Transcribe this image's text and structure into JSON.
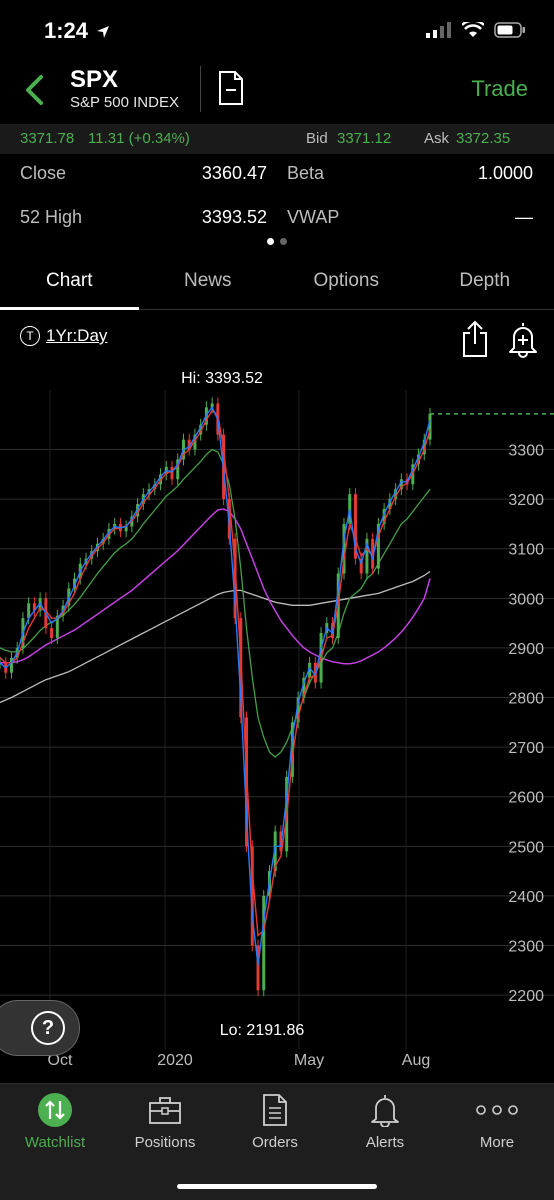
{
  "status_bar": {
    "time": "1:24"
  },
  "header": {
    "symbol": "SPX",
    "name": "S&P 500 INDEX",
    "trade_label": "Trade"
  },
  "quote": {
    "last": "3371.78",
    "change": "11.31 (+0.34%)",
    "bid_label": "Bid",
    "bid": "3371.12",
    "ask_label": "Ask",
    "ask": "3372.35"
  },
  "stats": {
    "close_label": "Close",
    "close": "3360.47",
    "beta_label": "Beta",
    "beta": "1.0000",
    "high52_label": "52 High",
    "high52": "3393.52",
    "vwap_label": "VWAP",
    "vwap": "—"
  },
  "tabs": [
    {
      "label": "Chart",
      "active": true
    },
    {
      "label": "News"
    },
    {
      "label": "Options"
    },
    {
      "label": "Depth"
    }
  ],
  "chart_toolbar": {
    "timeframe_badge": "T",
    "timeframe": "1Yr:Day"
  },
  "chart_data": {
    "type": "line",
    "hi_label": "Hi: 3393.52",
    "lo_label": "Lo: 2191.86",
    "y_ticks": [
      3300,
      3200,
      3100,
      3000,
      2900,
      2800,
      2700,
      2600,
      2500,
      2400,
      2300,
      2200
    ],
    "ylim": [
      2170,
      3420
    ],
    "x_tick_labels": [
      "Oct",
      "2020",
      "May",
      "Aug"
    ],
    "last_price_line": 3371.78,
    "colors": {
      "price_up": "#4caf50",
      "price_down": "#e53935",
      "ma_fast": "#2979ff",
      "ma_short": "#e53935",
      "ma_mid": "#43a047",
      "ma_long": "#c040e0",
      "ma_longest": "#bdbdbd"
    },
    "price_series": [
      2870,
      2850,
      2880,
      2900,
      2960,
      2990,
      2975,
      3000,
      2940,
      2920,
      2965,
      2985,
      3020,
      3040,
      3070,
      3080,
      3095,
      3110,
      3120,
      3140,
      3150,
      3135,
      3145,
      3165,
      3190,
      3210,
      3220,
      3230,
      3250,
      3265,
      3240,
      3280,
      3320,
      3300,
      3330,
      3350,
      3385,
      3393,
      3330,
      3200,
      3120,
      2960,
      2760,
      2500,
      2300,
      2210,
      2400,
      2450,
      2530,
      2490,
      2640,
      2750,
      2800,
      2840,
      2870,
      2830,
      2930,
      2950,
      2920,
      3050,
      3150,
      3210,
      3080,
      3050,
      3120,
      3060,
      3150,
      3180,
      3200,
      3220,
      3240,
      3230,
      3270,
      3290,
      3320,
      3372
    ],
    "ma_fast": [
      2870,
      2860,
      2870,
      2890,
      2930,
      2960,
      2975,
      2990,
      2970,
      2950,
      2960,
      2975,
      3000,
      3025,
      3055,
      3075,
      3090,
      3105,
      3118,
      3133,
      3145,
      3142,
      3145,
      3160,
      3180,
      3200,
      3215,
      3228,
      3245,
      3258,
      3255,
      3270,
      3300,
      3305,
      3325,
      3345,
      3370,
      3385,
      3360,
      3260,
      3150,
      2990,
      2800,
      2560,
      2360,
      2260,
      2350,
      2430,
      2500,
      2500,
      2600,
      2720,
      2790,
      2830,
      2860,
      2845,
      2900,
      2940,
      2930,
      3020,
      3120,
      3180,
      3100,
      3070,
      3110,
      3080,
      3140,
      3170,
      3195,
      3215,
      3235,
      3235,
      3260,
      3285,
      3315,
      3360
    ],
    "ma_short": [
      2880,
      2870,
      2870,
      2880,
      2910,
      2940,
      2960,
      2980,
      2975,
      2960,
      2960,
      2970,
      2990,
      3010,
      3040,
      3065,
      3085,
      3100,
      3112,
      3128,
      3140,
      3142,
      3146,
      3156,
      3172,
      3192,
      3208,
      3222,
      3238,
      3252,
      3256,
      3266,
      3290,
      3300,
      3318,
      3336,
      3360,
      3378,
      3370,
      3300,
      3200,
      3060,
      2880,
      2650,
      2450,
      2320,
      2330,
      2390,
      2460,
      2480,
      2560,
      2680,
      2760,
      2805,
      2840,
      2845,
      2880,
      2920,
      2925,
      2990,
      3080,
      3150,
      3120,
      3085,
      3100,
      3085,
      3125,
      3155,
      3180,
      3205,
      3225,
      3232,
      3252,
      3275,
      3300,
      3340
    ],
    "ma_mid": [
      2900,
      2895,
      2892,
      2892,
      2898,
      2910,
      2922,
      2935,
      2945,
      2952,
      2958,
      2966,
      2976,
      2988,
      3002,
      3018,
      3034,
      3050,
      3064,
      3078,
      3092,
      3102,
      3110,
      3120,
      3134,
      3150,
      3164,
      3178,
      3192,
      3206,
      3216,
      3226,
      3240,
      3252,
      3264,
      3276,
      3290,
      3300,
      3295,
      3270,
      3230,
      3160,
      3060,
      2940,
      2840,
      2760,
      2720,
      2690,
      2680,
      2690,
      2710,
      2740,
      2770,
      2800,
      2830,
      2850,
      2870,
      2890,
      2900,
      2930,
      2970,
      3000,
      3010,
      3020,
      3040,
      3050,
      3070,
      3090,
      3110,
      3130,
      3150,
      3160,
      3175,
      3190,
      3205,
      3220
    ],
    "ma_long": [
      2870,
      2870,
      2870,
      2872,
      2876,
      2882,
      2890,
      2898,
      2906,
      2912,
      2918,
      2924,
      2930,
      2936,
      2944,
      2952,
      2960,
      2968,
      2976,
      2984,
      2992,
      3000,
      3008,
      3016,
      3026,
      3036,
      3046,
      3056,
      3066,
      3076,
      3086,
      3096,
      3108,
      3120,
      3132,
      3144,
      3156,
      3168,
      3178,
      3180,
      3175,
      3160,
      3140,
      3110,
      3080,
      3050,
      3020,
      2995,
      2975,
      2955,
      2940,
      2925,
      2912,
      2900,
      2892,
      2886,
      2880,
      2876,
      2872,
      2870,
      2868,
      2868,
      2870,
      2874,
      2880,
      2886,
      2892,
      2900,
      2910,
      2920,
      2932,
      2946,
      2962,
      2980,
      3000,
      3040
    ],
    "ma_longest": [
      2790,
      2795,
      2800,
      2806,
      2812,
      2818,
      2824,
      2830,
      2836,
      2840,
      2844,
      2848,
      2852,
      2858,
      2864,
      2870,
      2876,
      2882,
      2888,
      2894,
      2900,
      2906,
      2912,
      2918,
      2924,
      2930,
      2936,
      2942,
      2948,
      2954,
      2960,
      2966,
      2972,
      2978,
      2984,
      2990,
      2996,
      3002,
      3008,
      3012,
      3014,
      3016,
      3016,
      3012,
      3008,
      3004,
      3000,
      2996,
      2992,
      2990,
      2988,
      2986,
      2986,
      2986,
      2986,
      2988,
      2990,
      2992,
      2994,
      2996,
      2998,
      3000,
      3002,
      3004,
      3006,
      3008,
      3010,
      3014,
      3018,
      3022,
      3026,
      3030,
      3034,
      3040,
      3046,
      3054
    ]
  },
  "help_label": "?",
  "bottom_nav": [
    {
      "label": "Watchlist",
      "icon": "watchlist-icon",
      "active": true
    },
    {
      "label": "Positions",
      "icon": "briefcase-icon"
    },
    {
      "label": "Orders",
      "icon": "document-icon"
    },
    {
      "label": "Alerts",
      "icon": "bell-icon"
    },
    {
      "label": "More",
      "icon": "more-icon"
    }
  ]
}
